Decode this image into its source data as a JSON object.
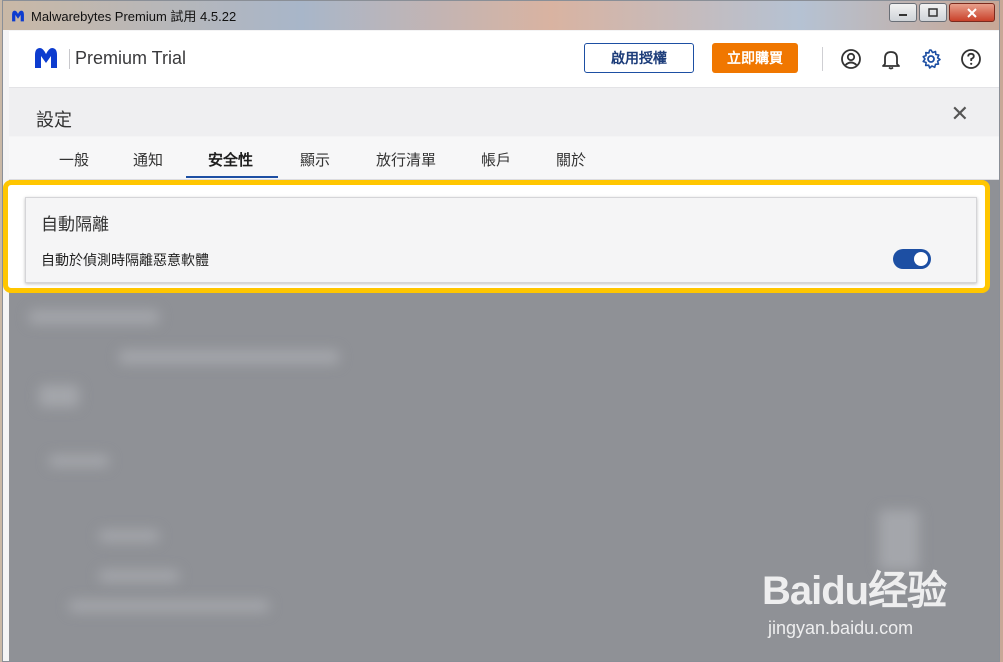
{
  "window": {
    "title": "Malwarebytes Premium 試用  4.5.22",
    "controls": [
      "minimize",
      "maximize",
      "close"
    ]
  },
  "header": {
    "brand_name": "Premium Trial",
    "activate_label": "啟用授權",
    "buy_label": "立即購買",
    "icons": [
      "account-icon",
      "bell-icon",
      "gear-icon",
      "help-icon"
    ],
    "accent_color": "#1d4fa3",
    "buy_color": "#f07700"
  },
  "settings": {
    "title": "設定",
    "close_label": "✕",
    "tabs": [
      {
        "label": "一般"
      },
      {
        "label": "通知"
      },
      {
        "label": "安全性",
        "active": true
      },
      {
        "label": "顯示"
      },
      {
        "label": "放行清單"
      },
      {
        "label": "帳戶"
      },
      {
        "label": "關於"
      }
    ]
  },
  "quarantine_card": {
    "title": "自動隔離",
    "description": "自動於偵測時隔離惡意軟體",
    "toggle_on": true
  },
  "watermark": {
    "main": "Baidu经验",
    "sub": "jingyan.baidu.com"
  }
}
